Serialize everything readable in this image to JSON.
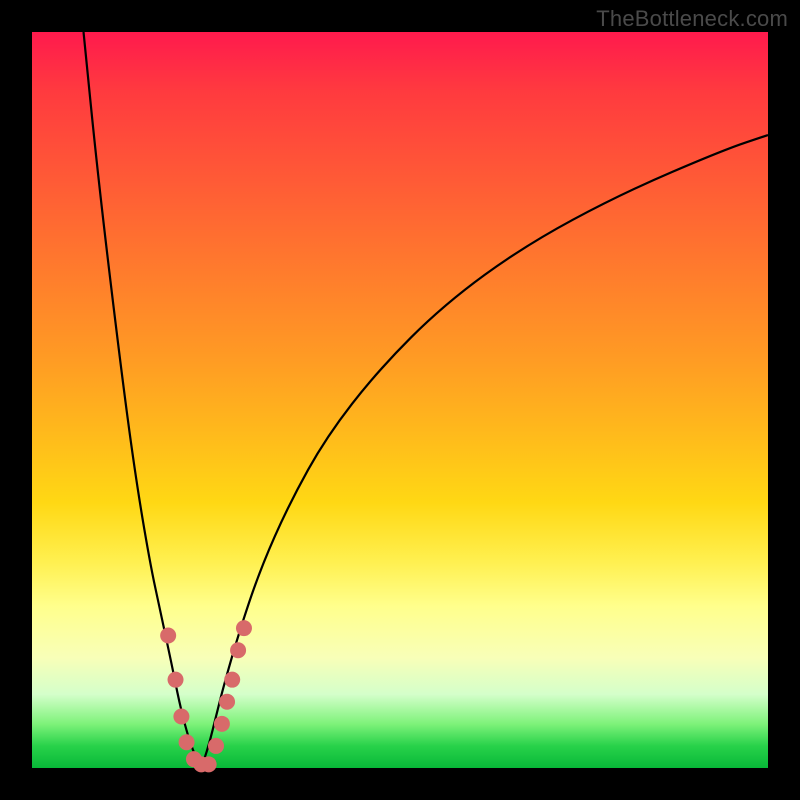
{
  "watermark": "TheBottleneck.com",
  "chart_data": {
    "type": "line",
    "title": "",
    "xlabel": "",
    "ylabel": "",
    "xlim": [
      0,
      100
    ],
    "ylim": [
      0,
      100
    ],
    "grid": false,
    "legend": false,
    "background_gradient_top_to_bottom": [
      "#ff1a4d",
      "#ffd814",
      "#ffff8c",
      "#08b838"
    ],
    "series": [
      {
        "name": "left-branch",
        "x": [
          7,
          9,
          12,
          14,
          16,
          17.5,
          19,
          20,
          21,
          22,
          23
        ],
        "y": [
          100,
          80,
          55,
          40,
          28,
          21,
          14,
          9,
          5,
          2,
          0
        ]
      },
      {
        "name": "right-branch",
        "x": [
          23,
          24,
          25,
          26,
          28,
          31,
          35,
          40,
          47,
          56,
          67,
          80,
          94,
          100
        ],
        "y": [
          0,
          3,
          7,
          11,
          18,
          27,
          36,
          45,
          54,
          63,
          71,
          78,
          84,
          86
        ]
      }
    ],
    "scatter_points": {
      "name": "highlight-dots",
      "note": "visually estimated marker positions near the valley",
      "points": [
        {
          "x": 18.5,
          "y": 18
        },
        {
          "x": 19.5,
          "y": 12
        },
        {
          "x": 20.3,
          "y": 7
        },
        {
          "x": 21.0,
          "y": 3.5
        },
        {
          "x": 22.0,
          "y": 1.2
        },
        {
          "x": 23.0,
          "y": 0.5
        },
        {
          "x": 24.0,
          "y": 0.5
        },
        {
          "x": 25.0,
          "y": 3
        },
        {
          "x": 25.8,
          "y": 6
        },
        {
          "x": 26.5,
          "y": 9
        },
        {
          "x": 27.2,
          "y": 12
        },
        {
          "x": 28.0,
          "y": 16
        },
        {
          "x": 28.8,
          "y": 19
        }
      ]
    }
  },
  "colors": {
    "frame": "#000000",
    "watermark": "#4a4a4a",
    "curve": "#000000",
    "dots": "#d86a6a"
  }
}
